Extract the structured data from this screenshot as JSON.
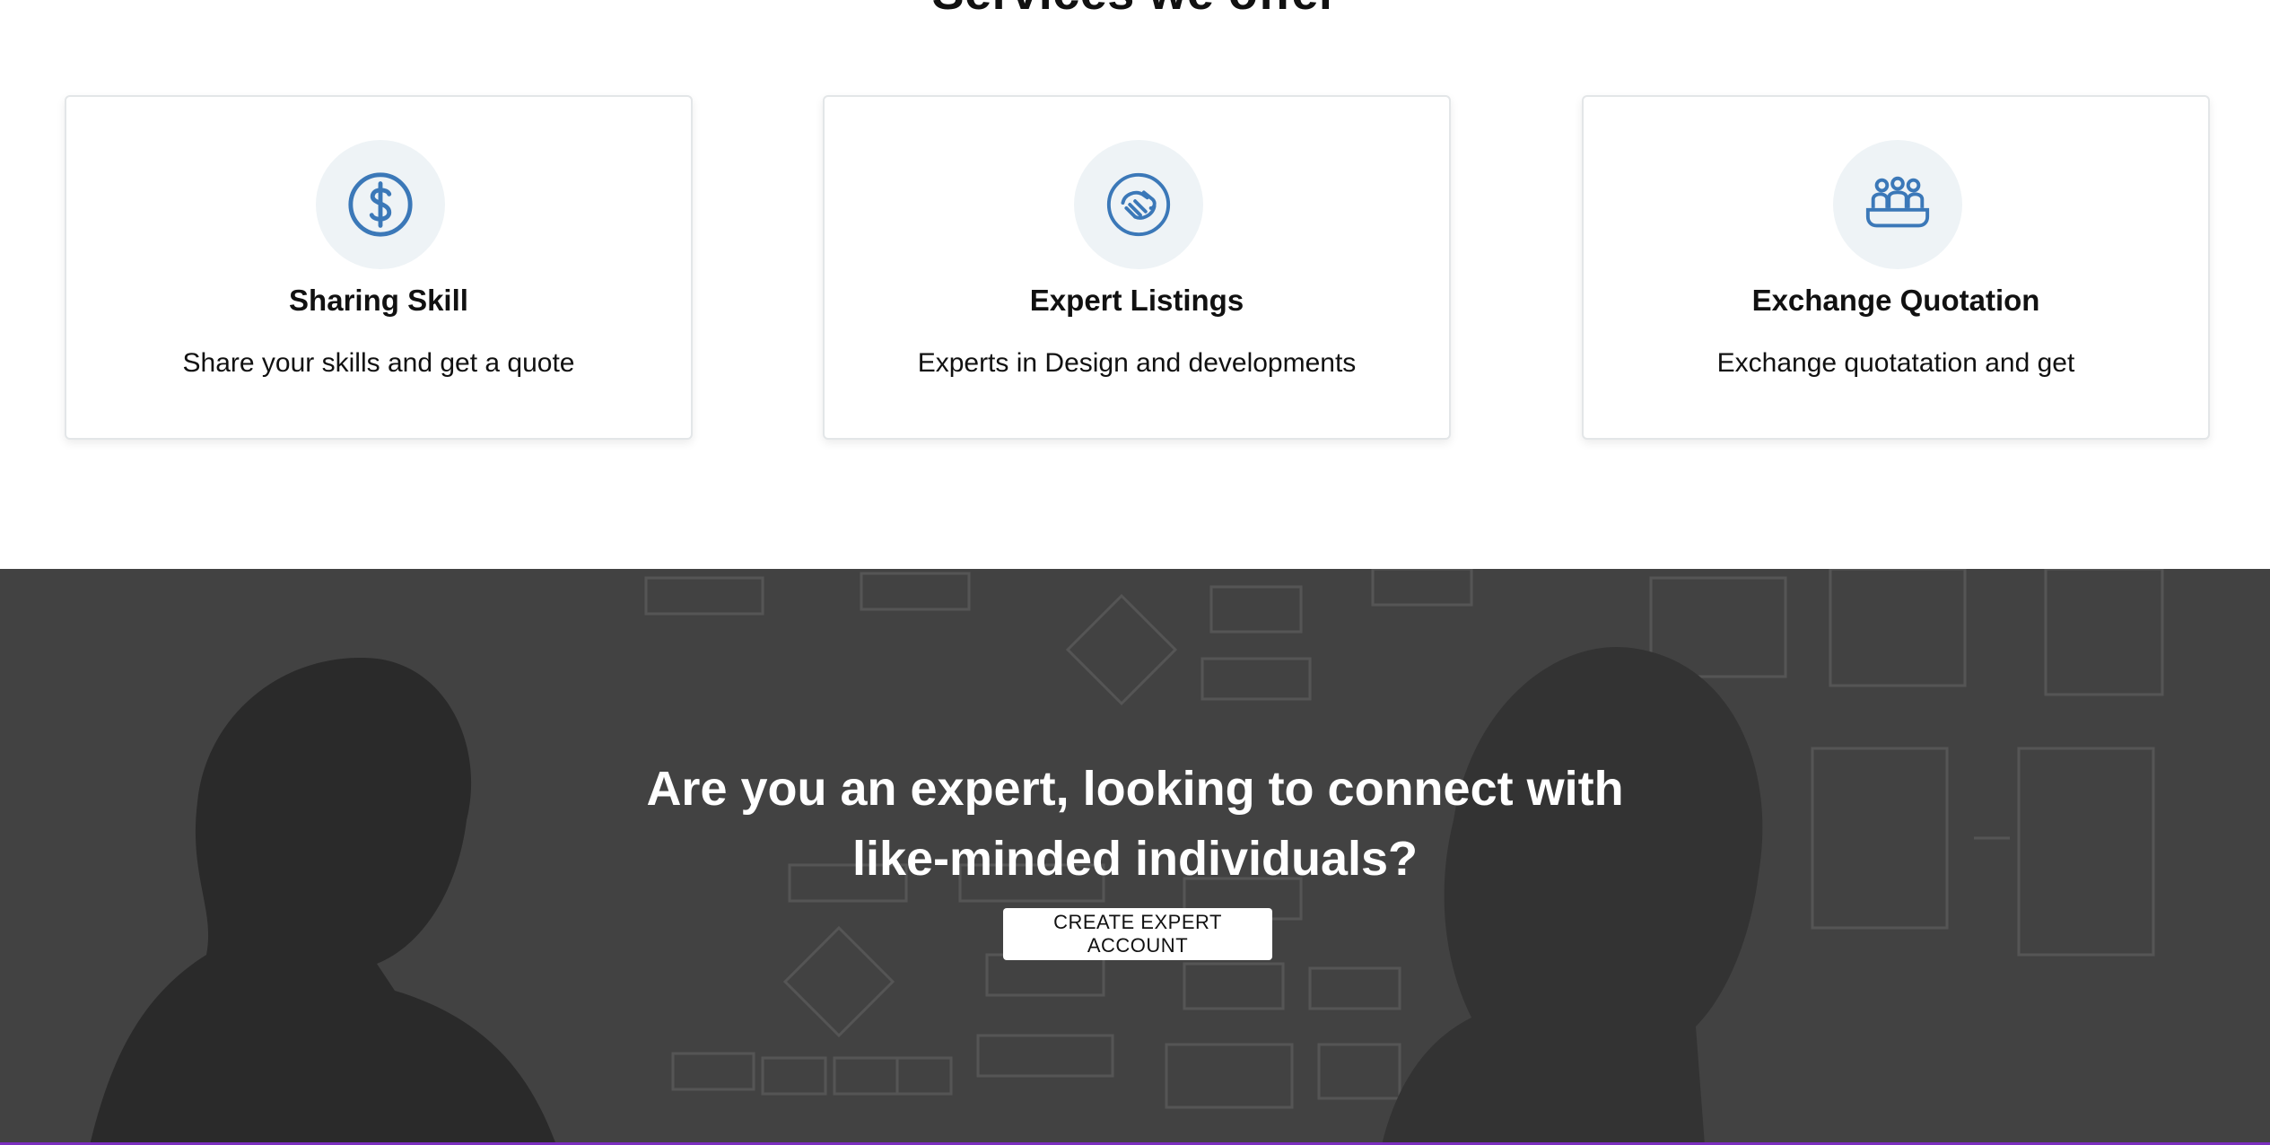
{
  "section": {
    "title": "Services we offer"
  },
  "cards": [
    {
      "icon": "dollar-icon",
      "title": "Sharing Skill",
      "description": "Share your skills and get a quote"
    },
    {
      "icon": "handshake-icon",
      "title": "Expert Listings",
      "description": "Experts in Design and developments"
    },
    {
      "icon": "team-icon",
      "title": "Exchange Quotation",
      "description": "Exchange quotatation and get"
    }
  ],
  "cta": {
    "heading_line1": "Are you an expert, looking to connect with",
    "heading_line2": "like-minded individuals?",
    "button_label": "CREATE EXPERT ACCOUNT"
  },
  "colors": {
    "icon_blue": "#3b78b8",
    "icon_bg": "#eef3f6",
    "cta_overlay": "#4a4a4a",
    "accent_line": "#7b2fbf"
  }
}
